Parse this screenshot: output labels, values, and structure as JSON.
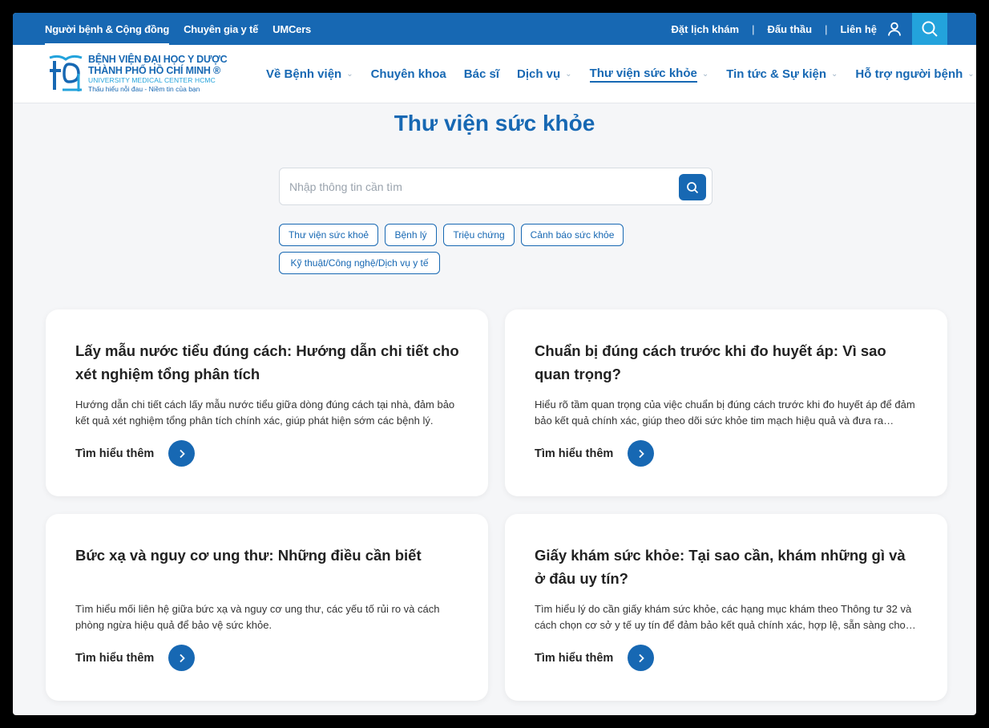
{
  "topbar": {
    "tabs": [
      "Người bệnh & Cộng đồng",
      "Chuyên gia y tế",
      "UMCers"
    ],
    "links": [
      "Đặt lịch khám",
      "Đấu thầu",
      "Liên hệ"
    ],
    "separator": "|"
  },
  "logo": {
    "line1": "BỆNH VIỆN ĐẠI HỌC Y DƯỢC",
    "line2": "THÀNH PHỐ HỒ CHÍ MINH ®",
    "line3": "UNIVERSITY MEDICAL CENTER HCMC",
    "line4": "Thấu hiểu nỗi đau - Niềm tin của bạn",
    "accent": "#1768b3",
    "secondary": "#23a3dc"
  },
  "menu": [
    {
      "label": "Về Bệnh viện",
      "dropdown": true
    },
    {
      "label": "Chuyên khoa",
      "dropdown": false
    },
    {
      "label": "Bác sĩ",
      "dropdown": false
    },
    {
      "label": "Dịch vụ",
      "dropdown": true
    },
    {
      "label": "Thư viện sức khỏe",
      "dropdown": true,
      "active": true
    },
    {
      "label": "Tin tức & Sự kiện",
      "dropdown": true
    },
    {
      "label": "Hỗ trợ người bệnh",
      "dropdown": true
    }
  ],
  "page": {
    "title": "Thư viện sức khỏe",
    "search_placeholder": "Nhập thông tin cần tìm"
  },
  "chips": [
    "Thư viện sức khoẻ",
    "Bệnh lý",
    "Triệu chứng",
    "Cảnh báo sức khỏe",
    "Kỹ thuật/Công nghệ/Dịch vụ y tế"
  ],
  "cards": [
    {
      "title": "Lấy mẫu nước tiểu đúng cách: Hướng dẫn chi tiết cho xét nghiệm tổng phân tích",
      "desc": "Hướng dẫn chi tiết cách lấy mẫu nước tiểu giữa dòng đúng cách tại nhà, đảm bảo kết quả xét nghiệm tổng phân tích chính xác, giúp phát hiện sớm các bệnh lý.",
      "more": "Tìm hiểu thêm"
    },
    {
      "title": "Chuẩn bị đúng cách trước khi đo huyết áp: Vì sao quan trọng?",
      "desc": "Hiểu rõ tầm quan trọng của việc chuẩn bị đúng cách trước khi đo huyết áp để đảm bảo kết quả chính xác, giúp theo dõi sức khỏe tim mạch hiệu quả và đưa ra…",
      "more": "Tìm hiểu thêm"
    },
    {
      "title": "Bức xạ và nguy cơ ung thư: Những điều cần biết",
      "desc": "Tìm hiểu mối liên hệ giữa bức xạ và nguy cơ ung thư, các yếu tố rủi ro và cách phòng ngừa hiệu quả để bảo vệ sức khỏe.",
      "more": "Tìm hiểu thêm"
    },
    {
      "title": "Giấy khám sức khỏe: Tại sao cần, khám những gì và ở đâu uy tín?",
      "desc": "Tìm hiểu lý do cần giấy khám sức khỏe, các hạng mục khám theo Thông tư 32 và cách chọn cơ sở y tế uy tín để đảm bảo kết quả chính xác, hợp lệ, sẵn sàng cho…",
      "more": "Tìm hiểu thêm"
    }
  ]
}
